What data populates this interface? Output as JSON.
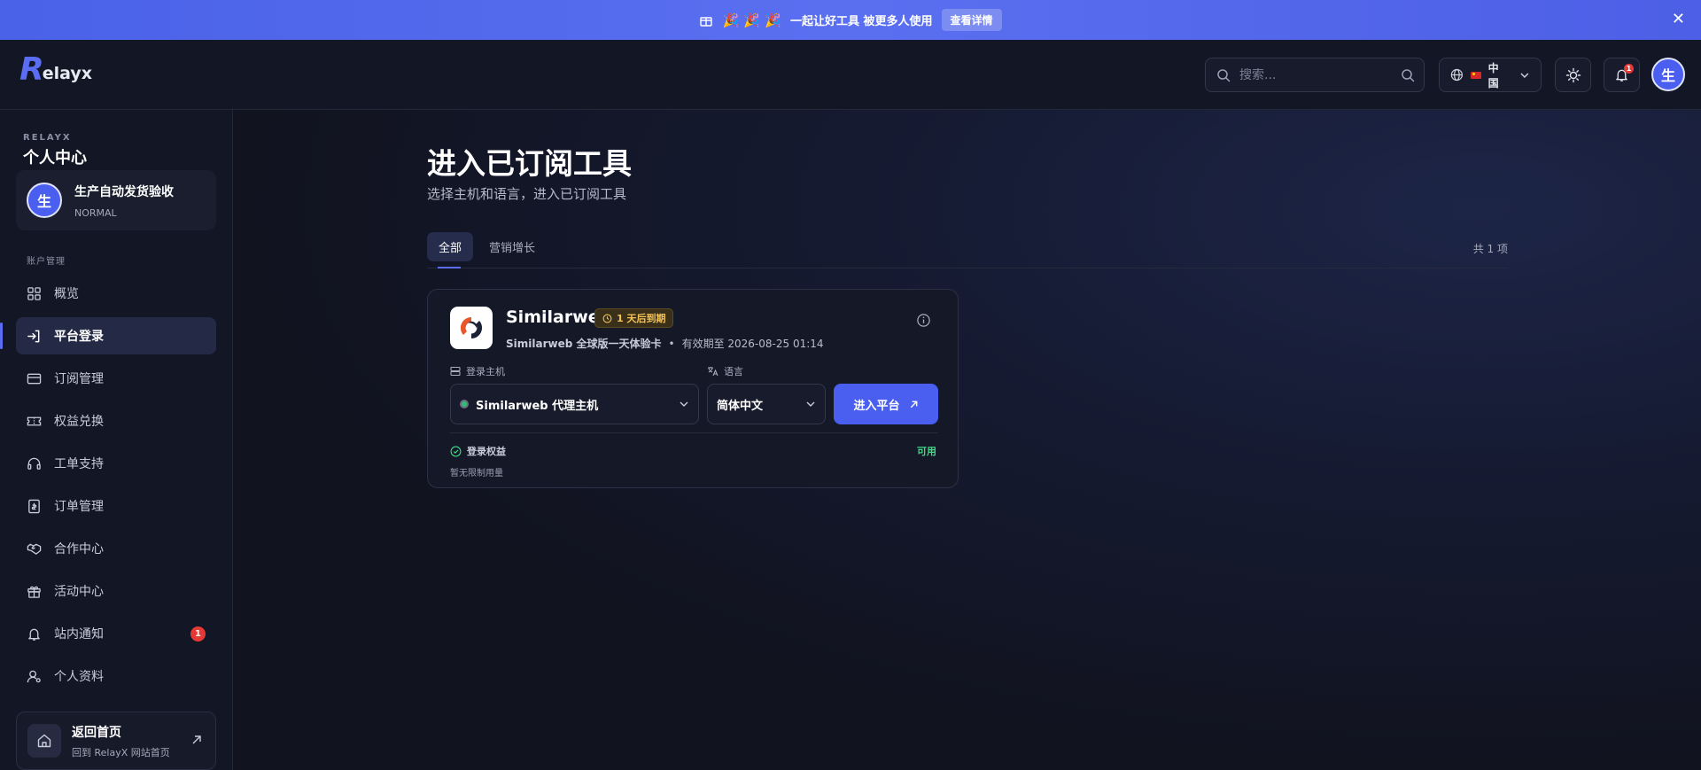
{
  "banner": {
    "emoji": "🎉 🎉 🎉",
    "text": "一起让好工具 被更多人使用",
    "button": "查看详情",
    "close": "✕"
  },
  "header": {
    "logo_initial": "R",
    "logo_rest": "elayx",
    "search_placeholder": "搜索...",
    "language": "中国",
    "notification_count": "1",
    "avatar": "生"
  },
  "sidebar": {
    "brand": "RELAYX",
    "title": "个人中心",
    "user": {
      "avatar": "生",
      "name": "生产自动发货验收",
      "level": "NORMAL"
    },
    "section": "账户管理",
    "items": [
      {
        "label": "概览",
        "icon": "grid-icon"
      },
      {
        "label": "平台登录",
        "icon": "login-icon",
        "active": true
      },
      {
        "label": "订阅管理",
        "icon": "card-icon"
      },
      {
        "label": "权益兑换",
        "icon": "ticket-icon"
      },
      {
        "label": "工单支持",
        "icon": "headset-icon"
      },
      {
        "label": "订单管理",
        "icon": "receipt-icon"
      },
      {
        "label": "合作中心",
        "icon": "handshake-icon"
      },
      {
        "label": "活动中心",
        "icon": "gift-icon"
      },
      {
        "label": "站内通知",
        "icon": "bell-icon",
        "badge": "1"
      },
      {
        "label": "个人资料",
        "icon": "user-icon"
      }
    ],
    "home": {
      "title": "返回首页",
      "subtitle": "回到 RelayX 网站首页"
    }
  },
  "main": {
    "title": "进入已订阅工具",
    "subtitle": "选择主机和语言，进入已订阅工具",
    "tabs": [
      {
        "label": "全部",
        "active": true
      },
      {
        "label": "营销增长"
      }
    ],
    "count": "共 1 项",
    "card": {
      "name": "Similarweb",
      "expire": "1 天后到期",
      "plan": "Similarweb 全球版一天体验卡",
      "validity": "有效期至 2026-08-25 01:14",
      "host_label": "登录主机",
      "host_value": "Similarweb 代理主机",
      "lang_label": "语言",
      "lang_value": "简体中文",
      "enter_button": "进入平台",
      "benefit_label": "登录权益",
      "benefit_status": "可用",
      "limit_text": "暂无限制用量"
    }
  },
  "colors": {
    "accent": "#4a5ef0",
    "badge": "#e53935",
    "available": "#3ddc84",
    "warning": "#f3c35a"
  }
}
